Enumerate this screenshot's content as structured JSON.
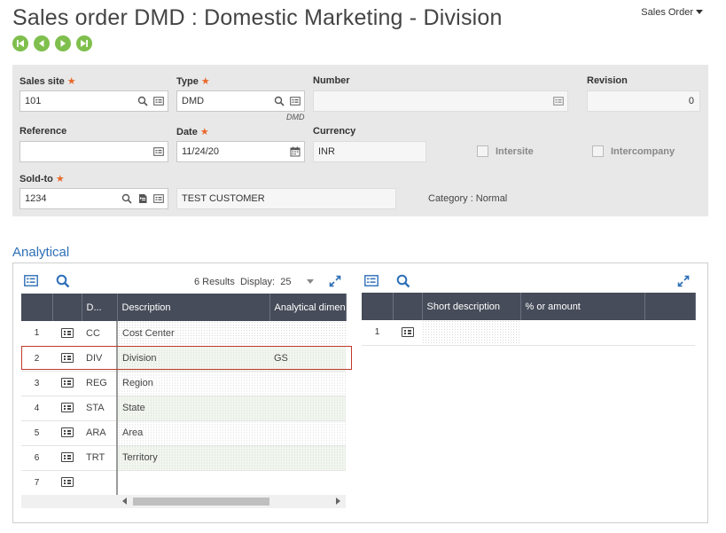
{
  "page": {
    "title": "Sales order DMD : Domestic Marketing - Division",
    "menu_label": "Sales Order",
    "nav": [
      "first-icon",
      "previous-icon",
      "next-icon",
      "last-icon"
    ]
  },
  "header": {
    "sales_site": {
      "label": "Sales site",
      "value": "101",
      "required": true
    },
    "type": {
      "label": "Type",
      "value": "DMD",
      "sublabel": "DMD",
      "required": true
    },
    "number": {
      "label": "Number",
      "value": ""
    },
    "revision": {
      "label": "Revision",
      "value": "0"
    },
    "reference": {
      "label": "Reference",
      "value": ""
    },
    "date": {
      "label": "Date",
      "value": "11/24/20",
      "required": true
    },
    "currency": {
      "label": "Currency",
      "value": "INR"
    },
    "intersite": {
      "label": "Intersite",
      "checked": false
    },
    "intercompany": {
      "label": "Intercompany",
      "checked": false
    },
    "sold_to": {
      "label": "Sold-to",
      "value": "1234",
      "name": "TEST CUSTOMER",
      "required": true
    },
    "category": "Category : Normal"
  },
  "analytical": {
    "section_title": "Analytical",
    "results_label": "6 Results",
    "display_label": "Display:",
    "display_value": "25",
    "left_columns": [
      "D...",
      "Description",
      "Analytical dimen"
    ],
    "left_rows": [
      {
        "num": "1",
        "code": "CC",
        "description": "Cost Center",
        "dimension": ""
      },
      {
        "num": "2",
        "code": "DIV",
        "description": "Division",
        "dimension": "GS"
      },
      {
        "num": "3",
        "code": "REG",
        "description": "Region",
        "dimension": ""
      },
      {
        "num": "4",
        "code": "STA",
        "description": "State",
        "dimension": ""
      },
      {
        "num": "5",
        "code": "ARA",
        "description": "Area",
        "dimension": ""
      },
      {
        "num": "6",
        "code": "TRT",
        "description": "Territory",
        "dimension": ""
      },
      {
        "num": "7",
        "code": "",
        "description": "",
        "dimension": ""
      }
    ],
    "right_columns": [
      "Short description",
      "% or amount"
    ],
    "right_rows": [
      {
        "num": "1",
        "short_description": "",
        "amount": ""
      }
    ]
  },
  "colors": {
    "accent_green": "#7fbf4d",
    "header_dark": "#464c59",
    "link_blue": "#2d6fb7",
    "required": "#e8682a",
    "highlight_border": "#c0392b"
  }
}
